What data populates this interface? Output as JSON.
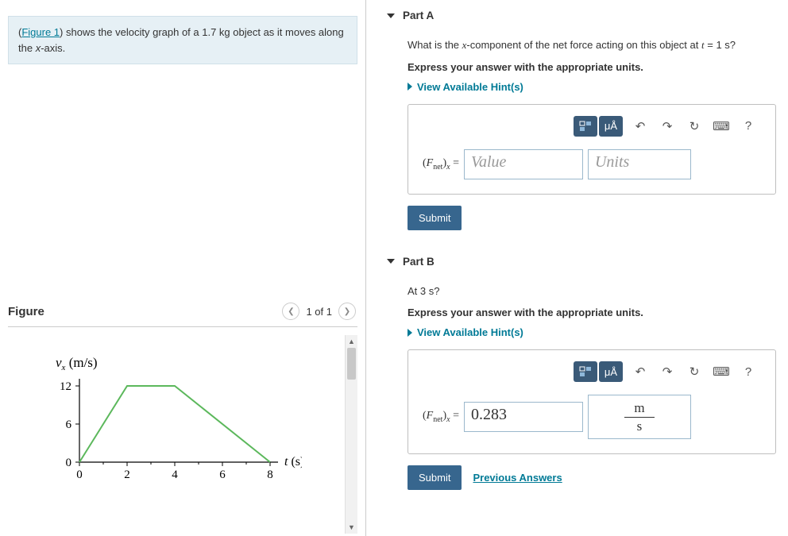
{
  "problem": {
    "figure_link": "Figure 1",
    "text_before": "(",
    "text_after": ") shows the velocity graph of a 1.7 kg object as it moves along the ",
    "var": "x",
    "text_end": "-axis."
  },
  "figure_panel": {
    "title": "Figure",
    "pager": "1 of 1"
  },
  "chart_data": {
    "type": "line",
    "xlabel": "t (s)",
    "ylabel": "vₓ (m/s)",
    "x": [
      0,
      2,
      4,
      8
    ],
    "y": [
      0,
      12,
      12,
      0
    ],
    "xlim": [
      0,
      8
    ],
    "ylim": [
      0,
      12
    ],
    "xticks": [
      0,
      2,
      4,
      6,
      8
    ],
    "yticks": [
      0,
      6,
      12
    ]
  },
  "partA": {
    "title": "Part A",
    "question_pre": "What is the ",
    "question_var": "x",
    "question_mid": "-component of the net force acting on this object at ",
    "question_t": "t",
    "question_eq": " = 1 s?",
    "instruction": "Express your answer with the appropriate units.",
    "hints": "View Available Hint(s)",
    "label_pre": "(",
    "label_F": "F",
    "label_sub1": "net",
    "label_close": ")",
    "label_sub2": "x",
    "label_eq": " =",
    "value_placeholder": "Value",
    "units_placeholder": "Units",
    "mu": "μÅ",
    "submit": "Submit"
  },
  "partB": {
    "title": "Part B",
    "question": "At 3 s?",
    "instruction": "Express your answer with the appropriate units.",
    "hints": "View Available Hint(s)",
    "value": "0.283",
    "unit_num": "m",
    "unit_den": "s",
    "mu": "μÅ",
    "submit": "Submit",
    "prev": "Previous Answers"
  }
}
